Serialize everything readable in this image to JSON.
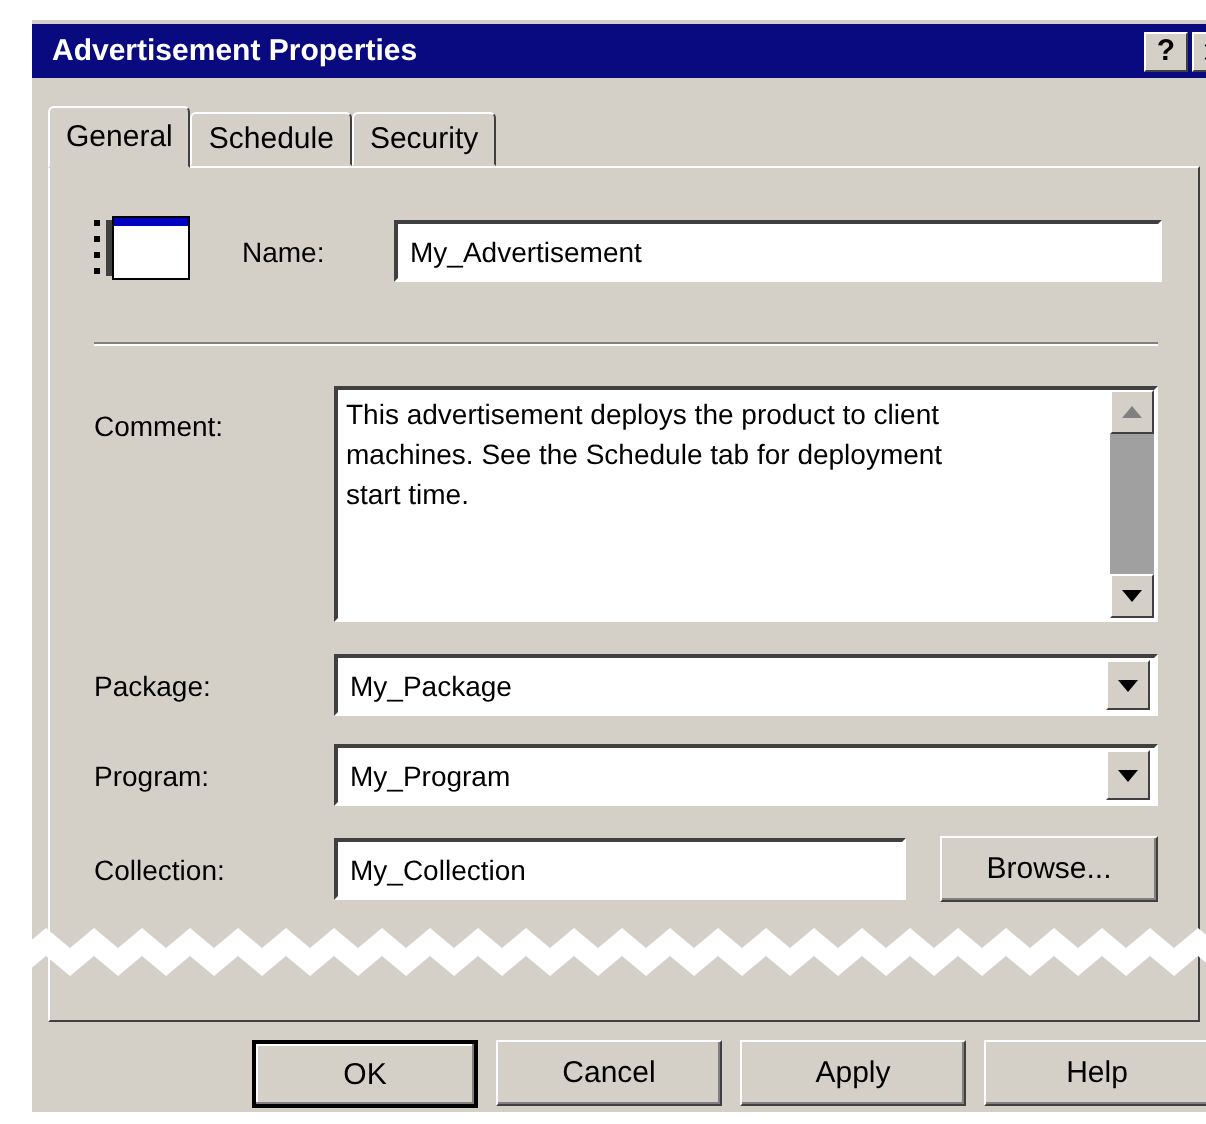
{
  "window": {
    "title": "Advertisement Properties",
    "help_button": "?"
  },
  "tabs": [
    {
      "label": "General",
      "selected": true
    },
    {
      "label": "Schedule",
      "selected": false
    },
    {
      "label": "Security",
      "selected": false
    }
  ],
  "name": {
    "label": "Name:",
    "value": "My_Advertisement"
  },
  "comment": {
    "label": "Comment:",
    "value": "This advertisement deploys the product to client machines. See the Schedule tab for deployment start time."
  },
  "package": {
    "label": "Package:",
    "value": "My_Package"
  },
  "program": {
    "label": "Program:",
    "value": "My_Program"
  },
  "collection": {
    "label": "Collection:",
    "value": "My_Collection",
    "browse_button": "Browse..."
  },
  "buttons": [
    {
      "label": "OK",
      "default": true
    },
    {
      "label": "Cancel",
      "default": false
    },
    {
      "label": "Apply",
      "default": false
    },
    {
      "label": "Help",
      "default": false
    }
  ]
}
